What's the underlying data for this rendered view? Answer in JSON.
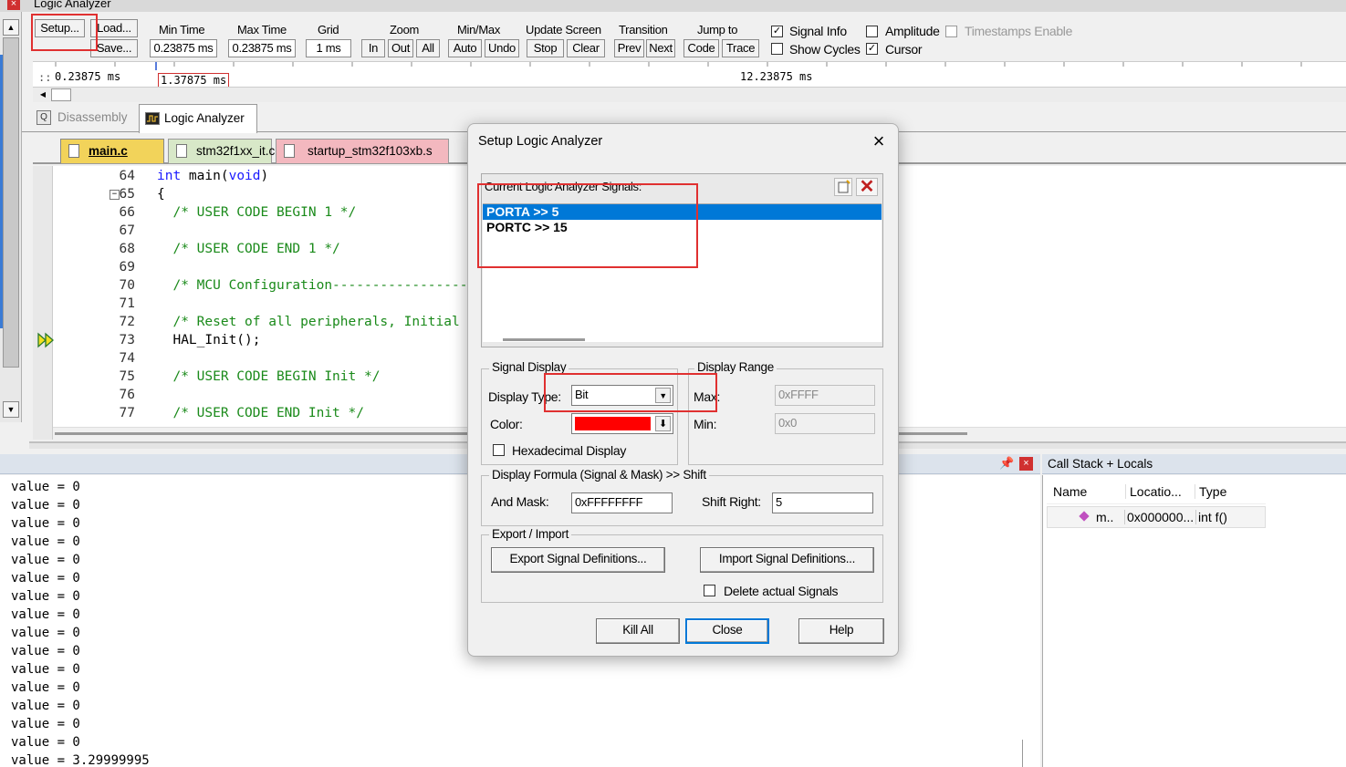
{
  "window": {
    "title": "Logic Analyzer"
  },
  "toolbar": {
    "setup": "Setup...",
    "load": "Load...",
    "save": "Save...",
    "min_time": {
      "label": "Min Time",
      "value": "0.23875 ms"
    },
    "max_time": {
      "label": "Max Time",
      "value": "0.23875 ms"
    },
    "grid": {
      "label": "Grid",
      "value": "1 ms"
    },
    "zoom": {
      "label": "Zoom",
      "in": "In",
      "out": "Out",
      "all": "All"
    },
    "minmax": {
      "label": "Min/Max",
      "auto": "Auto",
      "undo": "Undo"
    },
    "update_screen": {
      "label": "Update Screen",
      "stop": "Stop",
      "clear": "Clear"
    },
    "transition": {
      "label": "Transition",
      "prev": "Prev",
      "next": "Next"
    },
    "jump_to": {
      "label": "Jump to",
      "code": "Code",
      "trace": "Trace"
    },
    "signal_info": {
      "label": "Signal Info",
      "checked": true
    },
    "show_cycles": {
      "label": "Show Cycles",
      "checked": false
    },
    "amplitude": {
      "label": "Amplitude",
      "checked": false
    },
    "cursor": {
      "label": "Cursor",
      "checked": true
    },
    "timestamps": {
      "label": "Timestamps Enable",
      "checked": false
    }
  },
  "timeline": {
    "left": "0.23875 ms",
    "prefix": "::",
    "marker": "1.37875 ms",
    "right": "12.23875 ms"
  },
  "views": {
    "disassembly": "Disassembly",
    "logic_analyzer": "Logic Analyzer"
  },
  "file_tabs": [
    {
      "name": "main.c"
    },
    {
      "name": "stm32f1xx_it.c"
    },
    {
      "name": "startup_stm32f103xb.s"
    }
  ],
  "code": [
    {
      "ln": "64",
      "text": "int main(void)"
    },
    {
      "ln": "65",
      "text": "{"
    },
    {
      "ln": "66",
      "text": "  /* USER CODE BEGIN 1 */"
    },
    {
      "ln": "67",
      "text": ""
    },
    {
      "ln": "68",
      "text": "  /* USER CODE END 1 */"
    },
    {
      "ln": "69",
      "text": ""
    },
    {
      "ln": "70",
      "text": "  /* MCU Configuration--------------------"
    },
    {
      "ln": "71",
      "text": ""
    },
    {
      "ln": "72",
      "text": "  /* Reset of all peripherals, Initial"
    },
    {
      "ln": "73",
      "text": "  HAL_Init();"
    },
    {
      "ln": "74",
      "text": ""
    },
    {
      "ln": "75",
      "text": "  /* USER CODE BEGIN Init */"
    },
    {
      "ln": "76",
      "text": ""
    },
    {
      "ln": "77",
      "text": "  /* USER CODE END Init */"
    }
  ],
  "output_lines": [
    "value = 0",
    "value = 0",
    "value = 0",
    "value = 0",
    "value = 0",
    "value = 0",
    "value = 0",
    "value = 0",
    "value = 0",
    "value = 0",
    "value = 0",
    "value = 0",
    "value = 0",
    "value = 0",
    "value = 0",
    "value = 3.29999995"
  ],
  "call_stack": {
    "title": "Call Stack + Locals",
    "columns": [
      "Name",
      "Locatio...",
      "Type"
    ],
    "row": {
      "name": "m..",
      "location": "0x000000...",
      "type": "int f()"
    }
  },
  "dialog": {
    "title": "Setup Logic Analyzer",
    "signals_label": "Current Logic Analyzer Signals:",
    "signals": [
      "PORTA >> 5",
      "PORTC >> 15"
    ],
    "selected_index": 0,
    "signal_display": {
      "legend": "Signal Display",
      "display_type_label": "Display Type:",
      "display_type_value": "Bit",
      "color_label": "Color:",
      "color": "#ff0000",
      "hex_label": "Hexadecimal Display",
      "hex_checked": false
    },
    "display_range": {
      "legend": "Display Range",
      "max_label": "Max:",
      "max_value": "0xFFFF",
      "min_label": "Min:",
      "min_value": "0x0"
    },
    "formula": {
      "legend": "Display Formula (Signal & Mask) >> Shift",
      "mask_label": "And Mask:",
      "mask_value": "0xFFFFFFFF",
      "shift_label": "Shift Right:",
      "shift_value": "5"
    },
    "export_import": {
      "legend": "Export / Import",
      "export_btn": "Export Signal Definitions...",
      "import_btn": "Import Signal Definitions...",
      "delete_label": "Delete actual Signals",
      "delete_checked": false
    },
    "buttons": {
      "kill_all": "Kill All",
      "close": "Close",
      "help": "Help"
    }
  },
  "colors": {
    "accent_select": "#0078d7",
    "highlight_box": "#e03030",
    "comment": "#1a8a1a",
    "keyword": "#1a1aff"
  }
}
